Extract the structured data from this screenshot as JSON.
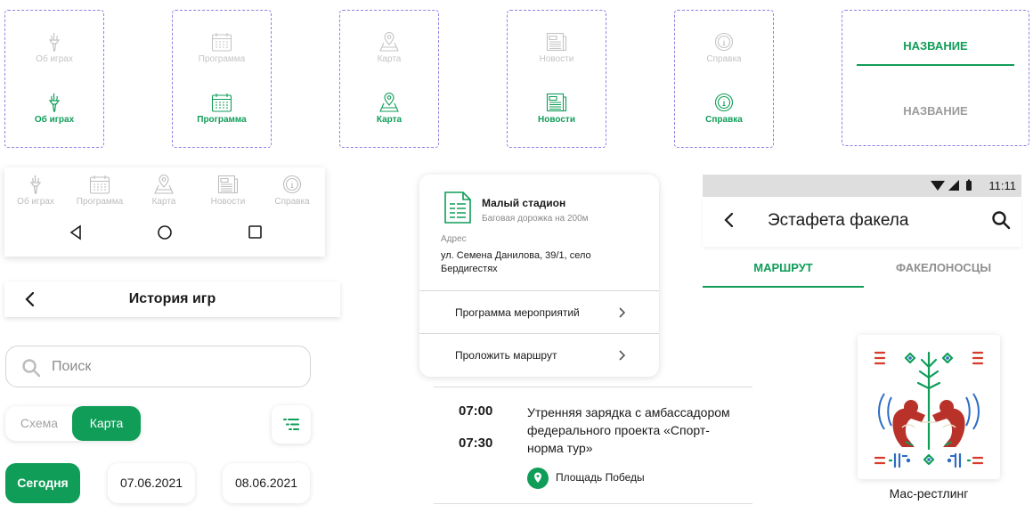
{
  "colors": {
    "accent": "#0f9d58",
    "inactive": "#c4c4c4",
    "dashed_border": "#8f82e6"
  },
  "nav_items": [
    {
      "icon": "torch-icon",
      "label": "Об играх"
    },
    {
      "icon": "calendar-icon",
      "label": "Программа"
    },
    {
      "icon": "map-pin-icon",
      "label": "Карта"
    },
    {
      "icon": "newspaper-icon",
      "label": "Новости"
    },
    {
      "icon": "info-icon",
      "label": "Справка"
    }
  ],
  "tabs_component": {
    "active": "НАЗВАНИЕ",
    "inactive": "НАЗВАНИЕ"
  },
  "system_nav": [
    "back-triangle-icon",
    "home-circle-icon",
    "recents-square-icon"
  ],
  "history_header": {
    "title": "История игр"
  },
  "search": {
    "placeholder": "Поиск"
  },
  "view_toggle": {
    "options": [
      "Схема",
      "Карта"
    ],
    "selected": "Карта"
  },
  "dates": [
    "Сегодня",
    "07.06.2021",
    "08.06.2021"
  ],
  "venue_card": {
    "name": "Малый стадион",
    "subtitle": "Баговая дорожка на 200м",
    "address_label": "Адрес",
    "address": "ул. Семена Данилова, 39/1, село Бердигестях",
    "actions": [
      "Программа мероприятий",
      "Проложить маршрут"
    ]
  },
  "schedule_item": {
    "start": "07:00",
    "end": "07:30",
    "title": "Утренняя зарядка с амбассадором федерального проекта «Спорт-норма тур»",
    "place": "Площадь Победы"
  },
  "status_bar": {
    "time": "11:11"
  },
  "app_bar": {
    "title": "Эстафета факела"
  },
  "app_tabs": {
    "active": "МАРШРУТ",
    "inactive": "ФАКЕЛОНОСЦЫ"
  },
  "sport_card": {
    "label": "Мас-рестлинг"
  }
}
